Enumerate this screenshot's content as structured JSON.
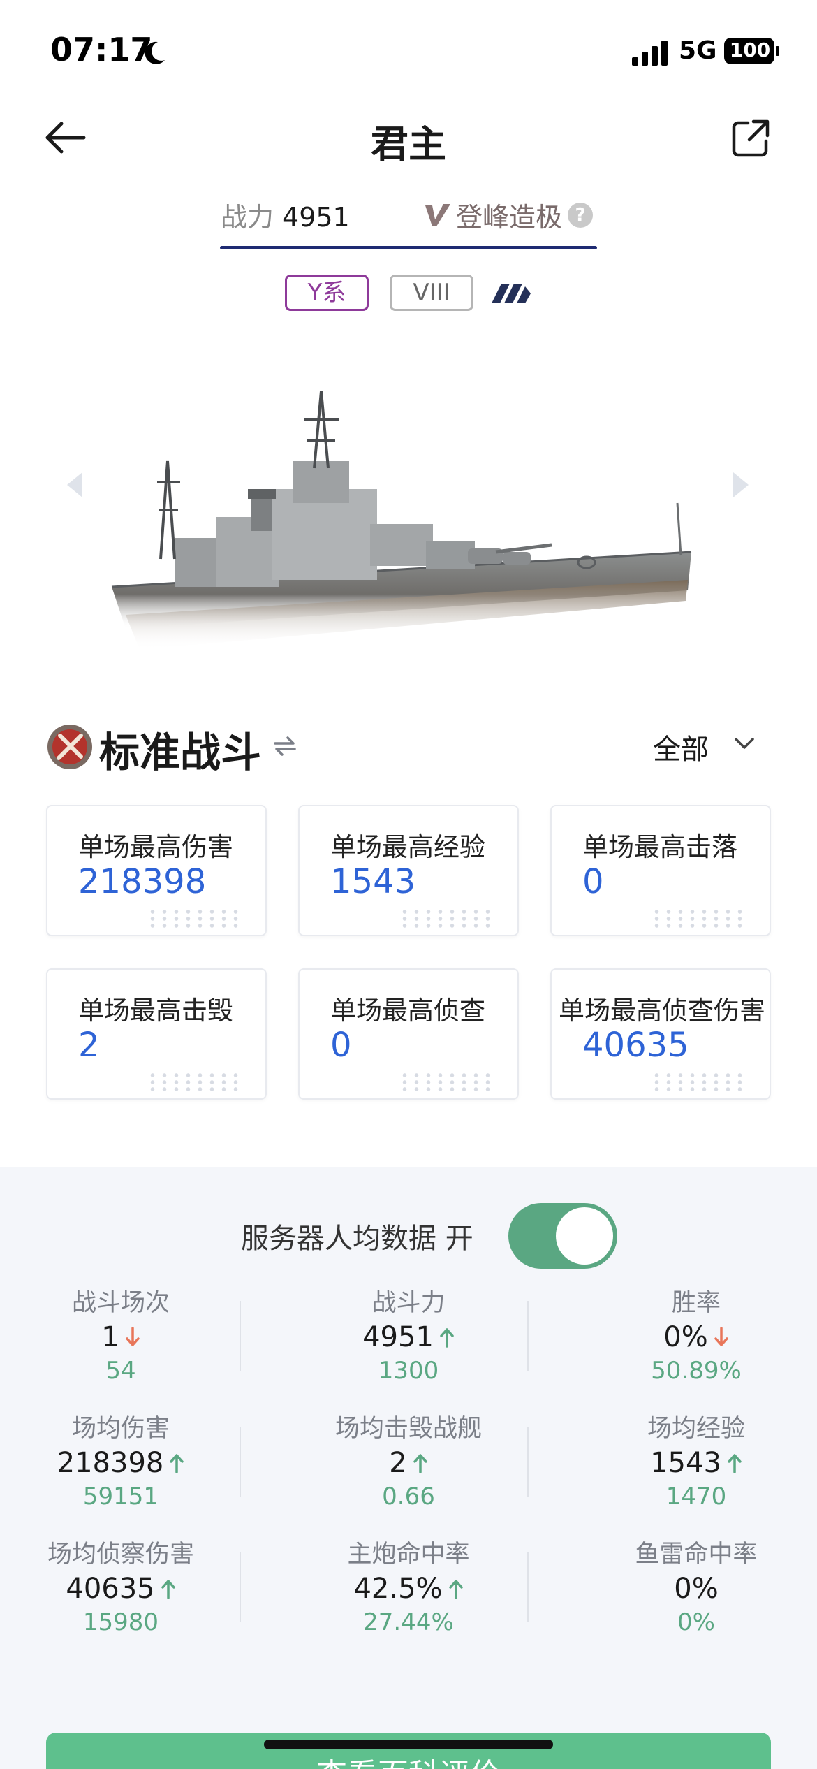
{
  "status_bar": {
    "time": "07:17",
    "network": "5G",
    "battery": "100"
  },
  "header": {
    "title": "君主"
  },
  "tabs": {
    "power_label": "战力",
    "power_value": "4951",
    "peak_label": "登峰造极",
    "help": "?"
  },
  "tags": {
    "nation": "Y系",
    "tier": "VIII"
  },
  "section": {
    "title": "标准战斗",
    "filter": "全部"
  },
  "cards": [
    {
      "label": "单场最高伤害",
      "value": "218398"
    },
    {
      "label": "单场最高经验",
      "value": "1543"
    },
    {
      "label": "单场最高击落",
      "value": "0"
    },
    {
      "label": "单场最高击毁",
      "value": "2"
    },
    {
      "label": "单场最高侦查",
      "value": "0"
    },
    {
      "label": "单场最高侦查伤害",
      "value": "40635"
    }
  ],
  "server_avg": {
    "label": "服务器人均数据 开",
    "enabled": true
  },
  "stats": [
    {
      "label": "战斗场次",
      "value": "1",
      "trend": "down",
      "avg": "54"
    },
    {
      "label": "战斗力",
      "value": "4951",
      "trend": "up",
      "avg": "1300"
    },
    {
      "label": "胜率",
      "value": "0%",
      "trend": "down",
      "avg": "50.89%"
    },
    {
      "label": "场均伤害",
      "value": "218398",
      "trend": "up",
      "avg": "59151"
    },
    {
      "label": "场均击毁战舰",
      "value": "2",
      "trend": "up",
      "avg": "0.66"
    },
    {
      "label": "场均经验",
      "value": "1543",
      "trend": "up",
      "avg": "1470"
    },
    {
      "label": "场均侦察伤害",
      "value": "40635",
      "trend": "up",
      "avg": "15980"
    },
    {
      "label": "主炮命中率",
      "value": "42.5%",
      "trend": "up",
      "avg": "27.44%"
    },
    {
      "label": "鱼雷命中率",
      "value": "0%",
      "trend": "none",
      "avg": "0%"
    }
  ],
  "cta": {
    "label": "查看百科评价"
  },
  "colors": {
    "accent_blue": "#2e63d6",
    "up_green": "#5aa782",
    "down_red": "#e8765a",
    "tab_underline": "#1e2a72",
    "nation_purple": "#8e3a9a"
  }
}
